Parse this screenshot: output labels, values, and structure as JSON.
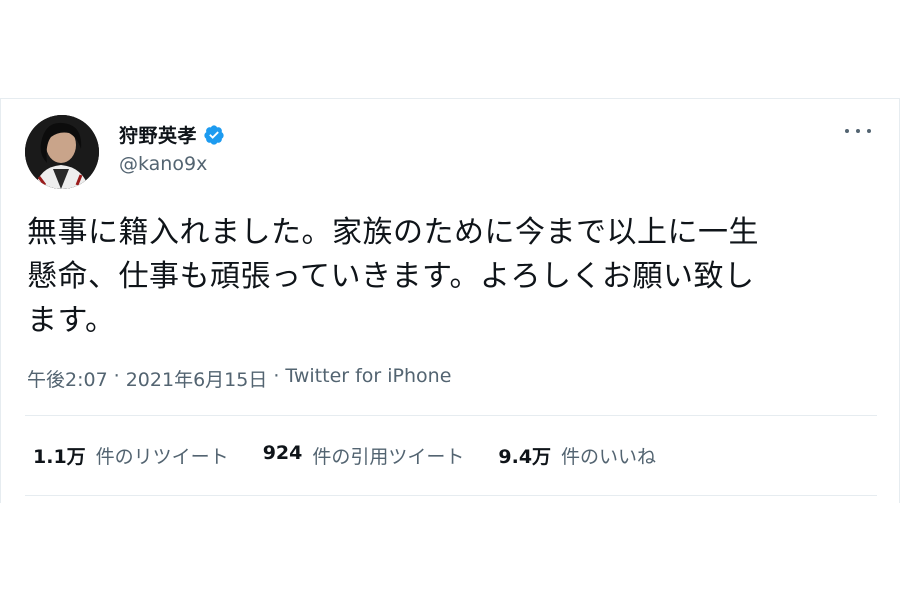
{
  "tweet": {
    "display_name": "狩野英孝",
    "verified_icon": "verified-badge-icon",
    "handle": "@kano9x",
    "text": "無事に籍入れました。家族のために今まで以上に一生\n懸命、仕事も頑張っていきます。よろしくお願い致し\nます。",
    "time": "午後2:07",
    "separator": "·",
    "date": "2021年6月15日",
    "source": "Twitter for iPhone",
    "stats": {
      "retweets": {
        "count": "1.1万",
        "label": "件のリツイート"
      },
      "quotes": {
        "count": "924",
        "label": "件の引用ツイート"
      },
      "likes": {
        "count": "9.4万",
        "label": "件のいいね"
      }
    }
  },
  "colors": {
    "text_primary": "#0f1419",
    "text_secondary": "#536471",
    "verified_blue": "#1d9bf0",
    "border": "#e6ecf0"
  },
  "icons": {
    "more": "more-horizontal-icon",
    "avatar": "avatar"
  }
}
